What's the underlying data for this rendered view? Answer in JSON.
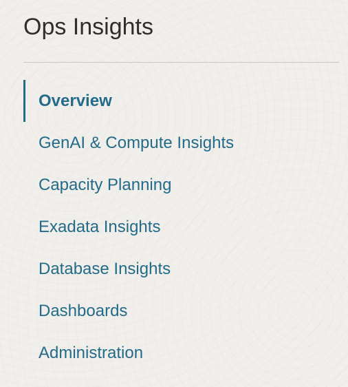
{
  "sidebar": {
    "title": "Ops Insights",
    "active_index": 0,
    "items": [
      {
        "label": "Overview"
      },
      {
        "label": "GenAI & Compute Insights"
      },
      {
        "label": "Capacity Planning"
      },
      {
        "label": "Exadata Insights"
      },
      {
        "label": "Database Insights"
      },
      {
        "label": "Dashboards"
      },
      {
        "label": "Administration"
      }
    ]
  },
  "colors": {
    "accent": "#236b88",
    "title_text": "#312d2a",
    "divider": "#c9c6c1",
    "background": "#f1efeb"
  }
}
